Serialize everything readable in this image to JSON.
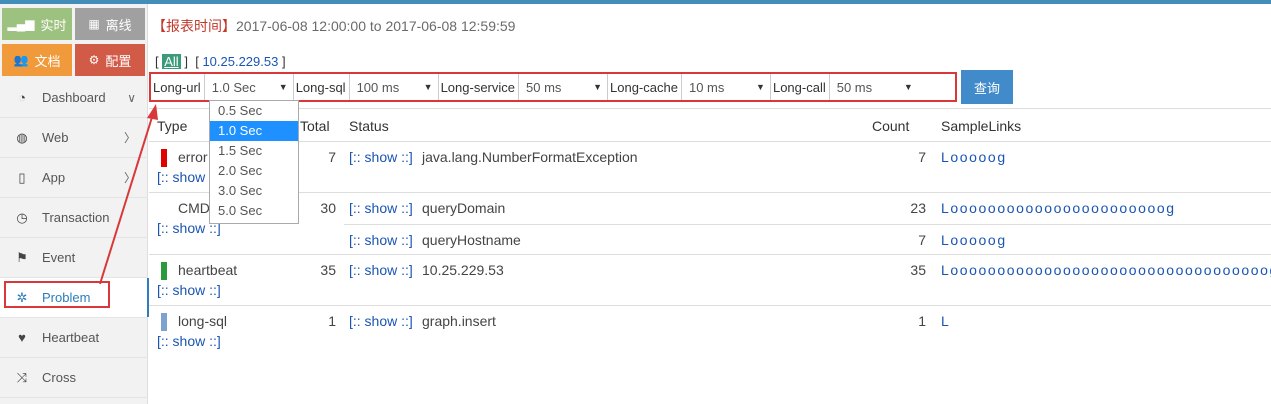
{
  "shortcuts": [
    {
      "label": "实时",
      "icon": "signal-icon",
      "color": "#9dc27f"
    },
    {
      "label": "离线",
      "icon": "film-icon",
      "color": "#a0a0a0"
    },
    {
      "label": "文档",
      "icon": "users-icon",
      "color": "#f09a3b"
    },
    {
      "label": "配置",
      "icon": "cogs-icon",
      "color": "#d15b47"
    }
  ],
  "nav": [
    {
      "label": "Dashboard",
      "icon": "dashboard-icon",
      "chevron": "∨"
    },
    {
      "label": "Web",
      "icon": "globe-icon",
      "chevron": "〉"
    },
    {
      "label": "App",
      "icon": "mobile-icon",
      "chevron": "〉"
    },
    {
      "label": "Transaction",
      "icon": "clock-icon",
      "chevron": ""
    },
    {
      "label": "Event",
      "icon": "flag-icon",
      "chevron": ""
    },
    {
      "label": "Problem",
      "icon": "bug-icon",
      "chevron": "",
      "active": true
    },
    {
      "label": "Heartbeat",
      "icon": "heart-icon",
      "chevron": ""
    },
    {
      "label": "Cross",
      "icon": "random-icon",
      "chevron": ""
    }
  ],
  "report": {
    "label": "【报表时间】",
    "range": "2017-06-08 12:00:00 to 2017-06-08 12:59:59"
  },
  "ip_filter": {
    "open1": "[",
    "all": "All",
    "close1": "]",
    "open2": "[",
    "ip": "10.25.229.53",
    "close2": "]"
  },
  "filters": [
    {
      "label": "Long-url",
      "value": "1.0 Sec"
    },
    {
      "label": "Long-sql",
      "value": "100 ms"
    },
    {
      "label": "Long-service",
      "value": "50 ms"
    },
    {
      "label": "Long-cache",
      "value": "10 ms"
    },
    {
      "label": "Long-call",
      "value": "50 ms"
    }
  ],
  "query_button": "查询",
  "dropdown": {
    "options": [
      "0.5 Sec",
      "1.0 Sec",
      "1.5 Sec",
      "2.0 Sec",
      "3.0 Sec",
      "5.0 Sec"
    ],
    "selected_index": 1
  },
  "table": {
    "headers": {
      "type": "Type",
      "total": "Total",
      "status": "Status",
      "count": "Count",
      "samples": "SampleLinks"
    },
    "groups": [
      {
        "type": "error",
        "color": "#e00000",
        "show": "[:: show ::]",
        "total": "7",
        "rows": [
          {
            "show": "[:: show ::]",
            "status": "java.lang.NumberFormatException",
            "count": "7",
            "samples": "Looooog"
          }
        ]
      },
      {
        "type": "CMD",
        "color": "",
        "show": "[:: show ::]",
        "total": "30",
        "rows": [
          {
            "show": "[:: show ::]",
            "status": "queryDomain",
            "count": "23",
            "samples": "Looooooooooooooooooooooog"
          },
          {
            "show": "[:: show ::]",
            "status": "queryHostname",
            "count": "7",
            "samples": "Looooog"
          }
        ]
      },
      {
        "type": "heartbeat",
        "color": "#2a9a3c",
        "show": "[:: show ::]",
        "total": "35",
        "rows": [
          {
            "show": "[:: show ::]",
            "status": "10.25.229.53",
            "count": "35",
            "samples": "Loooooooooooooooooooooooooooooooooog"
          }
        ]
      },
      {
        "type": "long-sql",
        "color": "#7ea2cf",
        "show": "[:: show ::]",
        "total": "1",
        "rows": [
          {
            "show": "[:: show ::]",
            "status": "graph.insert",
            "count": "1",
            "samples": "L"
          }
        ]
      }
    ]
  }
}
